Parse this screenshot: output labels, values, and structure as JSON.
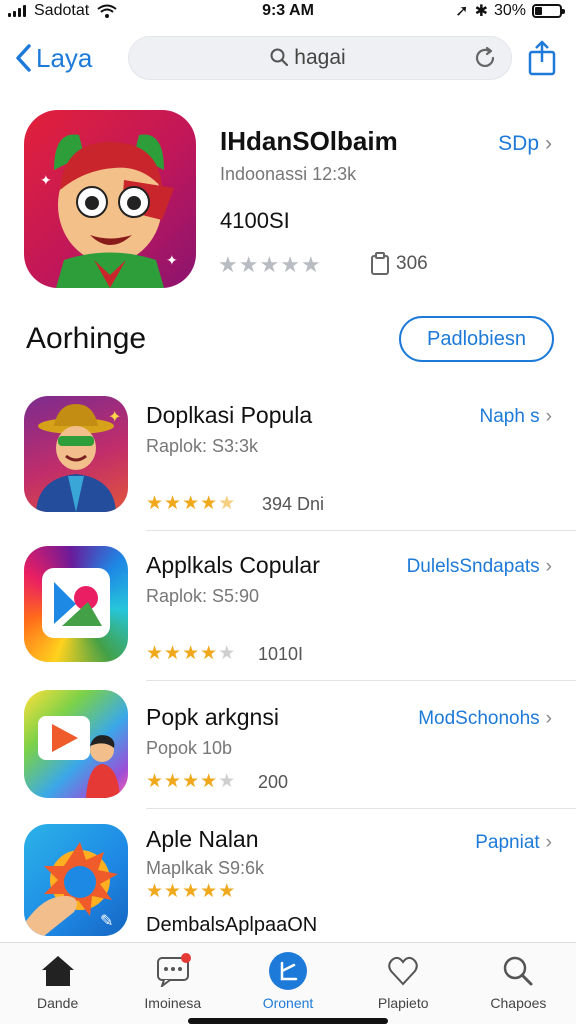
{
  "status_bar": {
    "carrier": "Sadotat",
    "time": "9:3 AM",
    "battery": "30%",
    "battery_level": 0.3
  },
  "nav": {
    "back_label": "Laya",
    "search_placeholder": "hagai",
    "icons": {
      "back": "chevron-left-icon",
      "search": "search-icon",
      "refresh": "refresh-icon",
      "share": "share-icon"
    }
  },
  "featured": {
    "title": "IHdanSOlbaim",
    "link_label": "SDp",
    "subtitle": "Indoonassi 12:3k",
    "price": "4100SI",
    "rating": 0,
    "size_label": "306"
  },
  "section": {
    "title": "Aorhinge",
    "button_label": "Padlobiesn"
  },
  "apps": [
    {
      "name": "Doplkasi Popula",
      "subtitle": "Raplok: S3:3k",
      "link": "Naph s",
      "rating": 4.5,
      "count": "394 Dni"
    },
    {
      "name": "Applkals Copular",
      "subtitle": "Raplok: S5:90",
      "link": "DulelsSndapats",
      "rating": 4,
      "count": "1010I"
    },
    {
      "name": "Popk arkgnsi",
      "subtitle": "Popok 10b",
      "link": "ModSchonohs",
      "rating": 4,
      "count": "200"
    },
    {
      "name": "Aple Nalan",
      "subtitle": "Maplkak S9:6k",
      "link": "Papniat",
      "rating": 5,
      "count": "",
      "extra": "DembalsAplpaaON"
    }
  ],
  "tabs": [
    {
      "label": "Dande",
      "icon": "home-icon",
      "active": false
    },
    {
      "label": "Imoinesa",
      "icon": "chat-icon",
      "active": false,
      "badge": true
    },
    {
      "label": "Oronent",
      "icon": "apps-icon",
      "active": true
    },
    {
      "label": "Plapieto",
      "icon": "heart-icon",
      "active": false
    },
    {
      "label": "Chapoes",
      "icon": "search-icon",
      "active": false
    }
  ],
  "colors": {
    "accent": "#1e7ad8",
    "star": "#f0a81c",
    "badge": "#e53935"
  }
}
